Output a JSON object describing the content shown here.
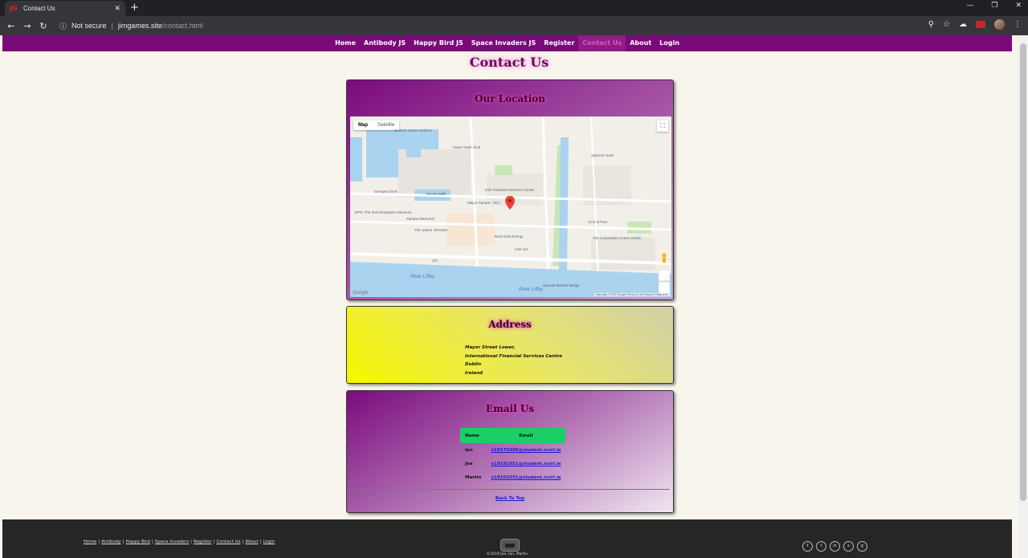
{
  "browser": {
    "tab_title": "Contact Us",
    "tab_favicon": "JG",
    "new_tab": "+",
    "security_label": "Not secure",
    "url_host": "jimgames.site",
    "url_path": "/contact.html"
  },
  "nav": {
    "items": [
      {
        "label": "Home"
      },
      {
        "label": "Antibody JS"
      },
      {
        "label": "Happy Bird JS"
      },
      {
        "label": "Space Invaders JS"
      },
      {
        "label": "Register"
      },
      {
        "label": "Contact Us"
      },
      {
        "label": "About"
      },
      {
        "label": "Login"
      }
    ],
    "active_index": 5,
    "color": "#7a0a7a"
  },
  "page_title": "Contact Us",
  "location": {
    "heading": "Our Location",
    "map": {
      "type_map": "Map",
      "type_satellite": "Satellite",
      "river": "River Liffey",
      "places": [
        "Custom House Harbour",
        "Swan Youth Club",
        "Spencer Dock",
        "Irish Financial Services Centre",
        "Mayor Square - NCI",
        "EPIC The Irish Emigration Museum",
        "The Jeanie Johnston",
        "Famine Memorial",
        "CCD & PwC",
        "The Convention Centre Dublin",
        "Irish Life",
        "Samuel Beckett Bridge",
        "Citi",
        "Bord Gáis Energy",
        "Georges Dock",
        "Excise Walk"
      ],
      "google": "Google",
      "footer": "Map data ©2020 Google  Terms of Use  Report a map error"
    }
  },
  "address": {
    "heading": "Address",
    "lines": [
      "Mayor Street Lower,",
      "International Financial Services Centre",
      "Dublin",
      "Ireland"
    ]
  },
  "email": {
    "heading": "Email Us",
    "col_name": "Name",
    "col_email": "Email",
    "rows": [
      {
        "name": "Ian",
        "email": "x19175400@student.ncirl.ie"
      },
      {
        "name": "Joe",
        "email": "x19181051@student.ncirl.ie"
      },
      {
        "name": "Martin",
        "email": "x19162031@student.ncirl.ie"
      }
    ],
    "back_to_top": "Back To Top",
    "table_header_color": "#19cf66"
  },
  "footer": {
    "links": [
      "Home",
      "Antibody",
      "Happy Bird",
      "Space Invaders",
      "Register",
      "Contact Us",
      "About",
      "Login"
    ],
    "separator": "|",
    "copyright": "©2019 Joe, Ian, Martin",
    "socials": [
      "facebook-icon",
      "twitter-icon",
      "linkedin-icon",
      "snapchat-icon",
      "github-icon"
    ],
    "social_glyphs": [
      "f",
      "t",
      "in",
      "s",
      "g"
    ]
  }
}
